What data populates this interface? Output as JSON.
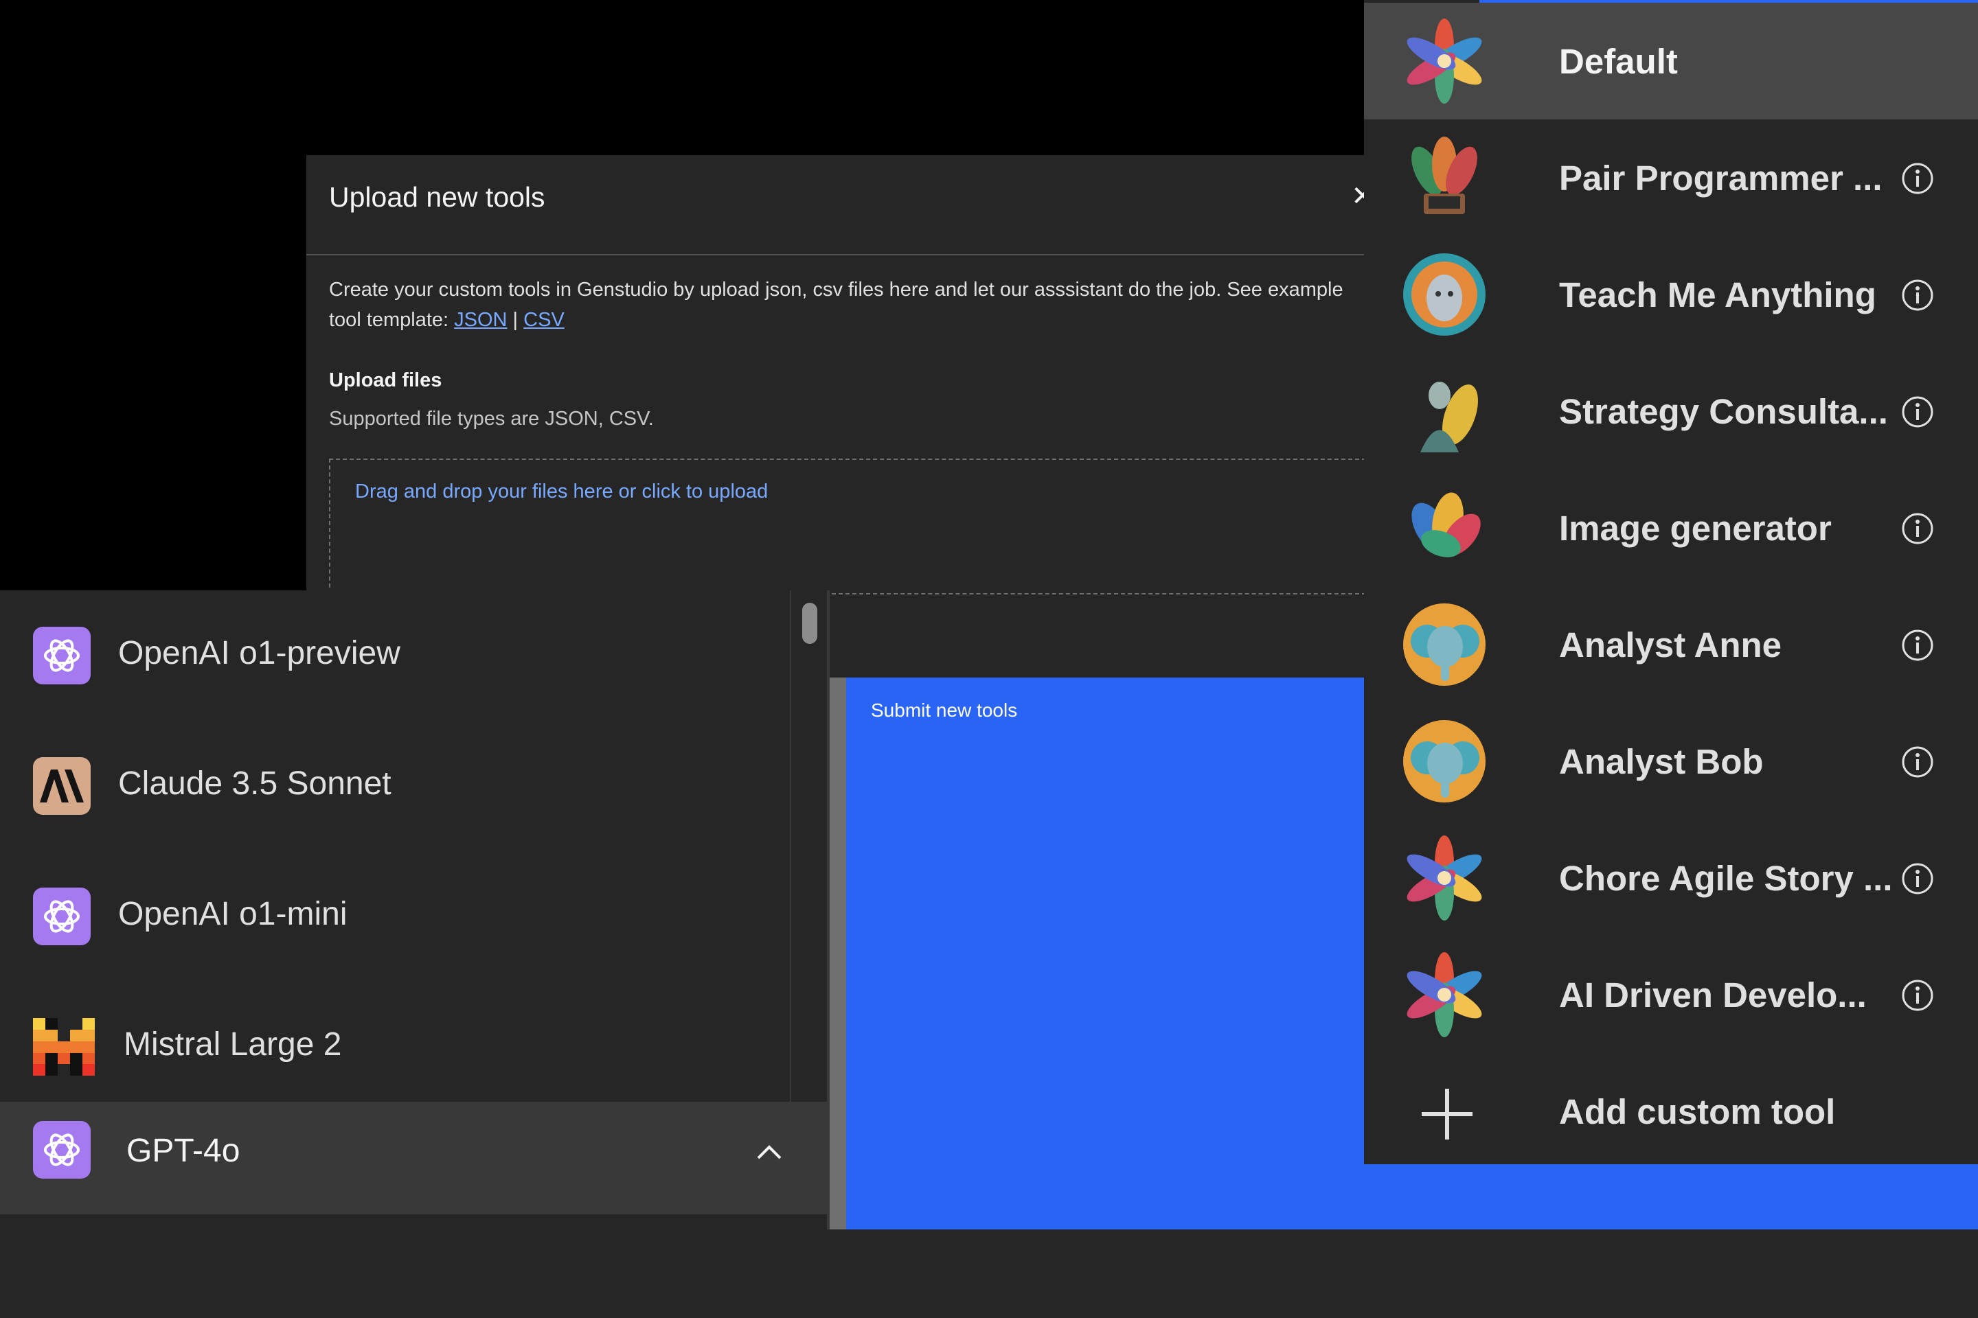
{
  "modal": {
    "title": "Upload new tools",
    "close_icon": "close-icon",
    "description_prefix": "Create your custom tools in Genstudio by upload json, csv files here and let our asssistant do the job. See example tool template: ",
    "json_link": "JSON",
    "separator": " | ",
    "csv_link": "CSV",
    "upload_heading": "Upload files",
    "supported_types": "Supported file types are JSON, CSV.",
    "dropzone_text": "Drag and drop your files here or click to upload"
  },
  "submit_button": {
    "label": "Submit new tools",
    "color": "#2a64f5"
  },
  "model_dropdown": {
    "items": [
      {
        "label": "OpenAI o1-preview",
        "icon": "openai-logo-icon"
      },
      {
        "label": "Claude 3.5 Sonnet",
        "icon": "anthropic-logo-icon"
      },
      {
        "label": "OpenAI o1-mini",
        "icon": "openai-logo-icon"
      },
      {
        "label": "Mistral Large 2",
        "icon": "mistral-logo-icon"
      }
    ],
    "selected": {
      "label": "GPT-4o",
      "icon": "openai-logo-icon",
      "toggle_icon": "chevron-up-icon"
    }
  },
  "assistants": {
    "items": [
      {
        "label": "Default",
        "active": true
      },
      {
        "label": "Pair Programmer ...",
        "info": true
      },
      {
        "label": "Teach Me Anything",
        "info": true
      },
      {
        "label": "Strategy Consulta...",
        "info": true
      },
      {
        "label": "Image generator",
        "info": true
      },
      {
        "label": "Analyst Anne",
        "info": true
      },
      {
        "label": "Analyst Bob",
        "info": true
      },
      {
        "label": "Chore Agile Story ...",
        "info": true
      },
      {
        "label": "AI Driven Develo...",
        "info": true
      }
    ],
    "add_label": "Add custom tool"
  },
  "colors": {
    "accent_blue": "#2a64f5",
    "link_blue": "#78a9ff",
    "openai_purple": "#a57af0",
    "claude_tan": "#d5a98a"
  }
}
